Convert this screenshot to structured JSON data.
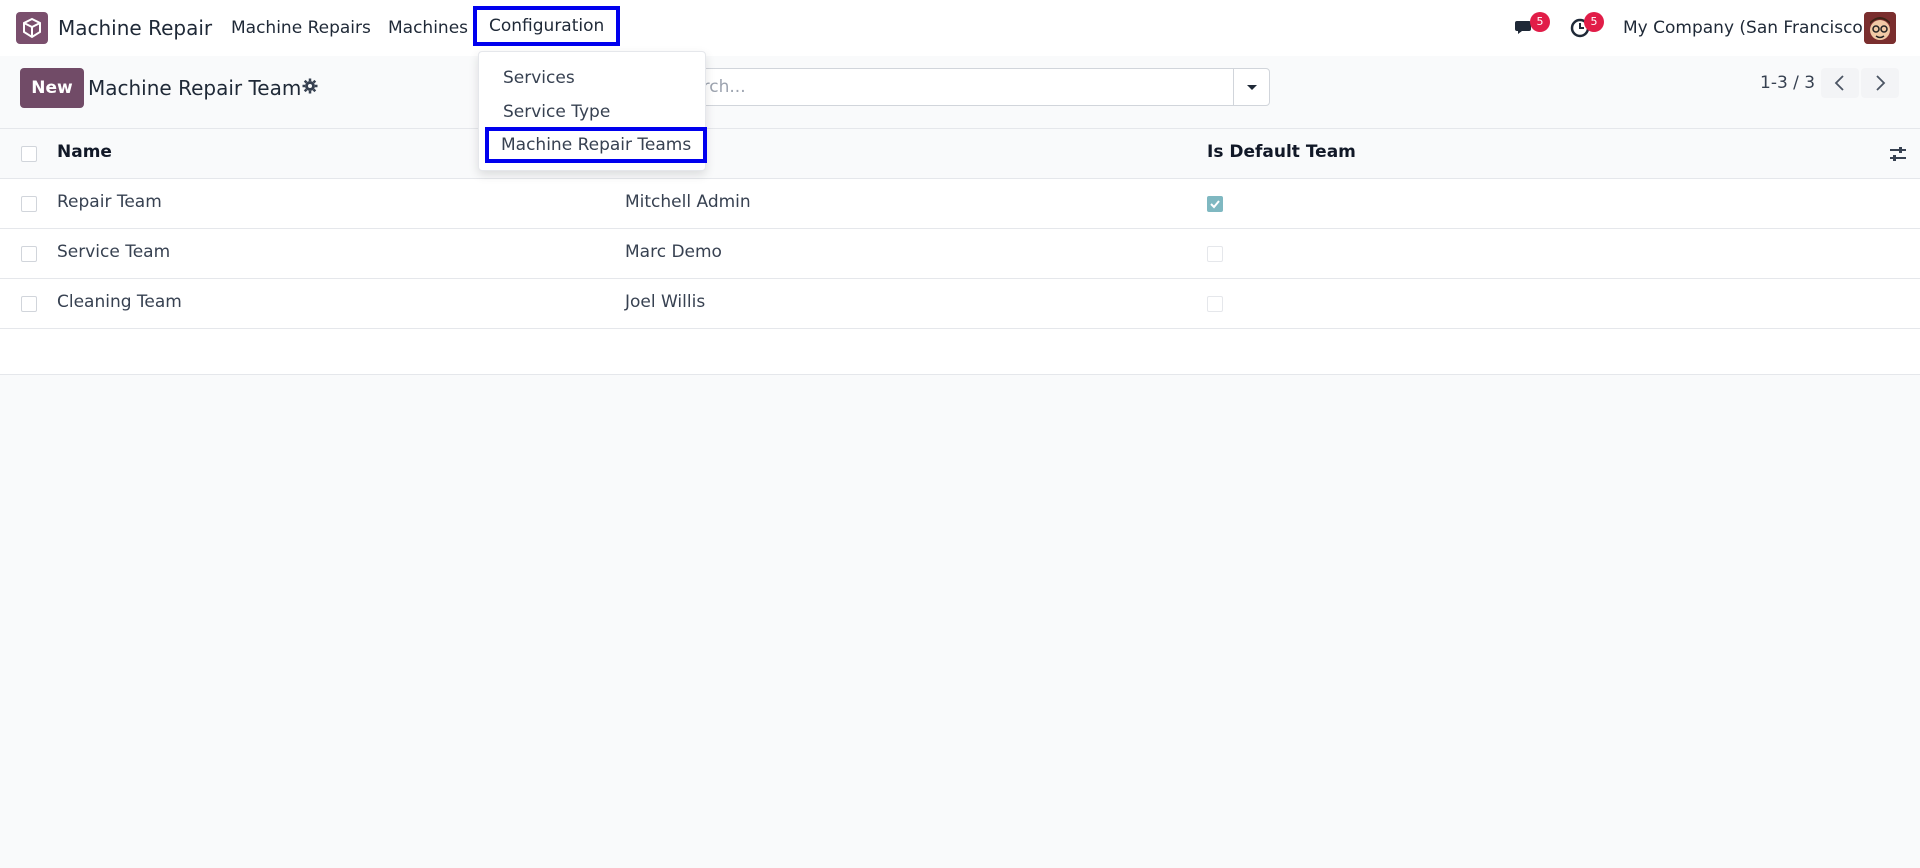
{
  "navbar": {
    "app_name": "Machine Repair",
    "menus": [
      "Machine Repairs",
      "Machines",
      "Configuration"
    ],
    "messages_badge": "5",
    "activities_badge": "5",
    "company": "My Company (San Francisco)"
  },
  "dropdown": {
    "items": [
      "Services",
      "Service Type",
      "Machine Repair Teams"
    ]
  },
  "control": {
    "new_label": "New",
    "title": "Machine Repair Team",
    "search_placeholder": "Search...",
    "pager": "1-3 / 3"
  },
  "table": {
    "headers": {
      "name": "Name",
      "default": "Is Default Team"
    },
    "rows": [
      {
        "name": "Repair Team",
        "leader": "Mitchell Admin",
        "is_default": true
      },
      {
        "name": "Service Team",
        "leader": "Marc Demo",
        "is_default": false
      },
      {
        "name": "Cleaning Team",
        "leader": "Joel Willis",
        "is_default": false
      }
    ]
  },
  "colors": {
    "brand": "#714b67",
    "highlight_outline": "#0000ee",
    "badge": "#e11d48",
    "checkbox_checked": "#7fb8c1"
  }
}
